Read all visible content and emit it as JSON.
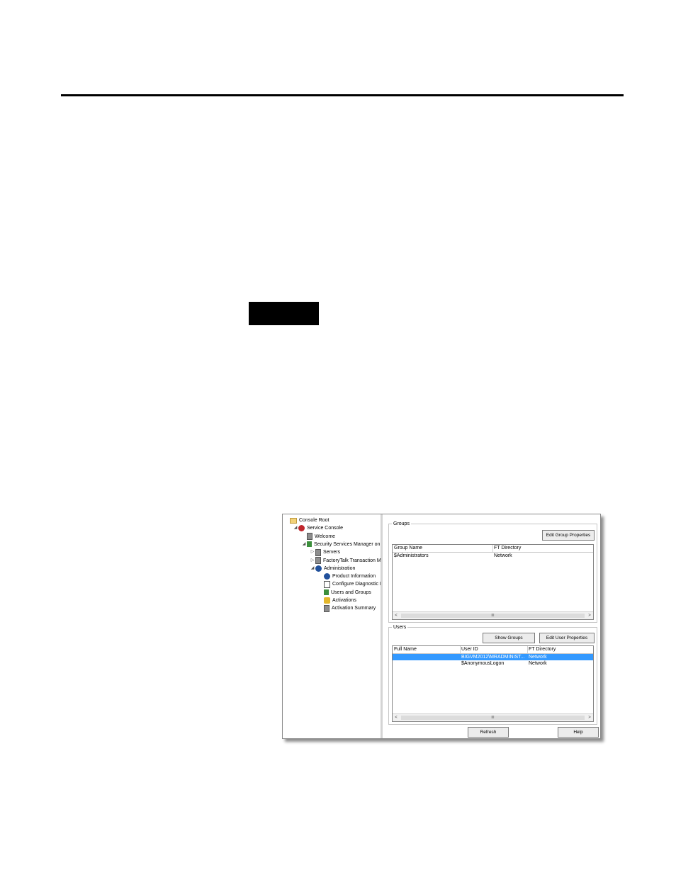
{
  "tree": [
    {
      "label": "Console Root",
      "icon": "folder-icon",
      "toggle": "",
      "indent": 0
    },
    {
      "label": "Service Console",
      "icon": "service-console-icon",
      "toggle": "◢",
      "indent": 1
    },
    {
      "label": "Welcome",
      "icon": "welcome-icon",
      "toggle": "",
      "indent": 2
    },
    {
      "label": "Security Services Manager on I",
      "icon": "security-manager-icon",
      "toggle": "◢",
      "indent": 2
    },
    {
      "label": "Servers",
      "icon": "servers-icon",
      "toggle": "▷",
      "indent": 3
    },
    {
      "label": "FactoryTalk Transaction M",
      "icon": "transaction-manager-icon",
      "toggle": "▷",
      "indent": 3
    },
    {
      "label": "Administration",
      "icon": "administration-icon",
      "toggle": "◢",
      "indent": 3
    },
    {
      "label": "Product Information",
      "icon": "product-info-icon",
      "toggle": "",
      "indent": 4
    },
    {
      "label": "Configure Diagnostic L",
      "icon": "diagnostic-icon",
      "toggle": "",
      "indent": 4
    },
    {
      "label": "Users and Groups",
      "icon": "users-groups-icon",
      "toggle": "",
      "indent": 4
    },
    {
      "label": "Activations",
      "icon": "activations-icon",
      "toggle": "",
      "indent": 4
    },
    {
      "label": "Activation Summary",
      "icon": "activation-summary-icon",
      "toggle": "",
      "indent": 4
    }
  ],
  "groups": {
    "label": "Groups",
    "edit_button": "Edit Group Properties",
    "columns": [
      "Group Name",
      "FT Directory"
    ],
    "rows": [
      [
        "$Administrators",
        "Network"
      ]
    ]
  },
  "users": {
    "label": "Users",
    "show_groups_button": "Show Groups",
    "edit_button": "Edit User Properties",
    "columns": [
      "Full Name",
      "User ID",
      "FT Directory"
    ],
    "rows": [
      [
        "",
        "BIGVM2012\\MRADMINIST...",
        "Network"
      ],
      [
        "",
        "$AnonymousLogon",
        "Network"
      ]
    ]
  },
  "scroll_thumb": "III",
  "footer": {
    "refresh": "Refresh",
    "help": "Help"
  }
}
